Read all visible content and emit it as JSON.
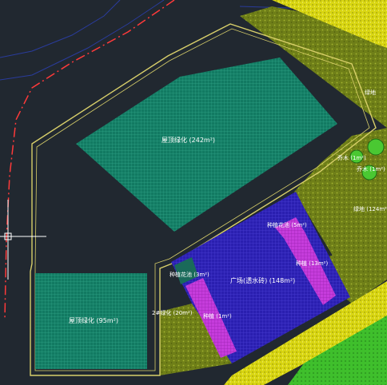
{
  "colors": {
    "background": "#212830",
    "boundary": "#d8cf6a",
    "roof_green": "#127a62",
    "lawn": "#7f8e1e",
    "plaza_blue": "#2a1fb0",
    "purple": "#c63cdc",
    "yellow_strip": "#d9d612",
    "bright_green": "#3fbf2c",
    "red_dash": "#ff3a3a",
    "road_line": "#2a3c9c"
  },
  "labels": {
    "roof_green_top": "屋顶绿化 (242m²)",
    "roof_green_bottom": "屋顶绿化 (95m²)",
    "plaza": "广场(透水砖) (148m²)",
    "planting_top": "种植花池 (5m²)",
    "planting_right": "种植 (13m²)",
    "planting_left": "种植花池 (3m²)",
    "planting_bottom": "种植 (1m²)",
    "lawn_left": "2#绿化 (20m²)",
    "lawn_right": "绿地 (124m²)",
    "lawn_top_right": "绿地",
    "tree_a": "乔木 (1m²)",
    "tree_b": "乔木 (1m²)"
  },
  "cursor": {
    "label": "crosshair"
  }
}
